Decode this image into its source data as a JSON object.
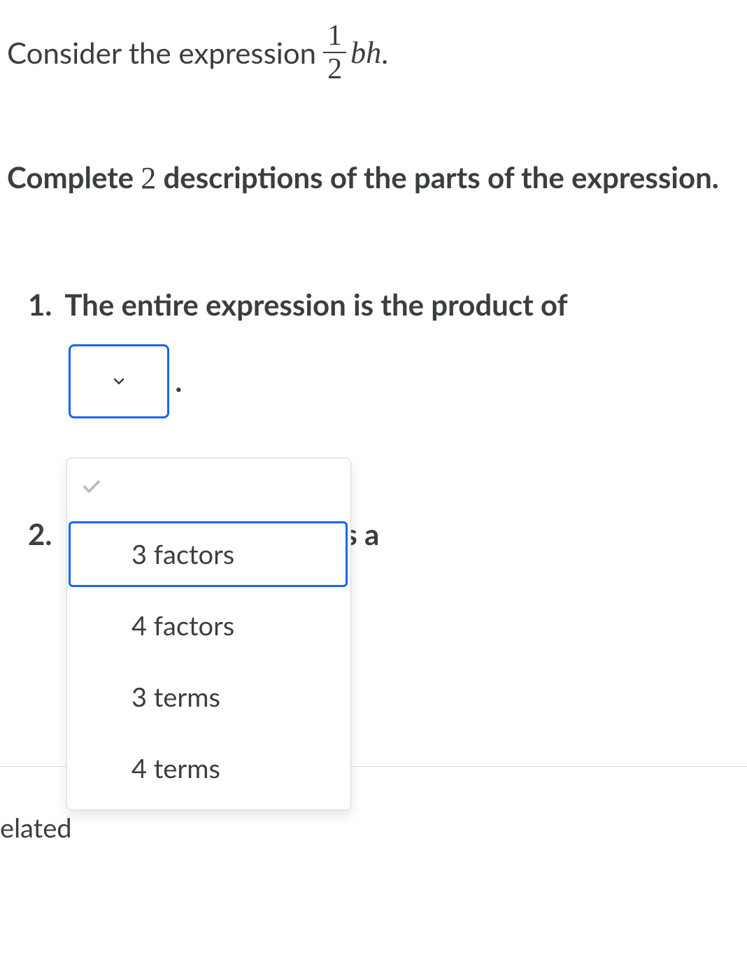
{
  "intro": {
    "prefix": "Consider the expression ",
    "fraction_num": "1",
    "fraction_den": "2",
    "vars": "bh",
    "suffix": "."
  },
  "instruction": {
    "pre": "Complete ",
    "count": "2",
    "post": " descriptions of the parts of the expression."
  },
  "items": {
    "one": {
      "number": "1.",
      "text_before": "The entire expression is the product of",
      "period": "."
    },
    "two": {
      "number": "2.",
      "text_after": "s a"
    }
  },
  "dropdown": {
    "options": [
      {
        "label": "3 factors",
        "highlighted": true
      },
      {
        "label": "4 factors",
        "highlighted": false
      },
      {
        "label": "3 terms",
        "highlighted": false
      },
      {
        "label": "4 terms",
        "highlighted": false
      }
    ]
  },
  "footer": {
    "text": "elated"
  }
}
